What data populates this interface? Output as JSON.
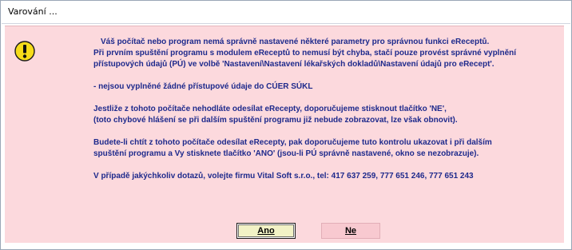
{
  "window": {
    "title": "Varování ..."
  },
  "icon": {
    "name": "warning-icon",
    "color": "#f6dc1a"
  },
  "message": {
    "lines": [
      "Váš počítač nebo program nemá správně nastavené některé parametry pro správnou funkci eReceptů.",
      "Při prvním spuštění programu s modulem eReceptů to nemusí být chyba, stačí pouze provést správné vyplnění",
      "přístupových údajů (PÚ) ve volbě 'Nastavení\\Nastavení lékařských dokladů\\Nastavení údajů pro eRecept'.",
      "- nejsou vyplněné žádné přístupové údaje do CÚER SÚKL",
      "Jestliže z tohoto počítače nehodláte odesílat eRecepty, doporučujeme stisknout tlačítko  'NE',",
      "(toto chybové hlášení se při dalším spuštění programu již nebude zobrazovat, lze však obnovit).",
      "Budete-li chtít z tohoto počítače odesílat eRecepty, pak doporučujeme tuto kontrolu ukazovat i při dalším",
      "spuštění programu a Vy stisknete tlačítko 'ANO'  (jsou-li PÚ správně nastavené, okno se nezobrazuje).",
      "V případě jakýchkoliv dotazů, volejte firmu Vital Soft s.r.o., tel: 417 637 259,  777 651 246,  777 651 243"
    ]
  },
  "buttons": {
    "yes_label": "Ano",
    "no_label": "Ne"
  },
  "colors": {
    "dialog_background": "#fcd9dd",
    "text": "#1e2a8c"
  }
}
